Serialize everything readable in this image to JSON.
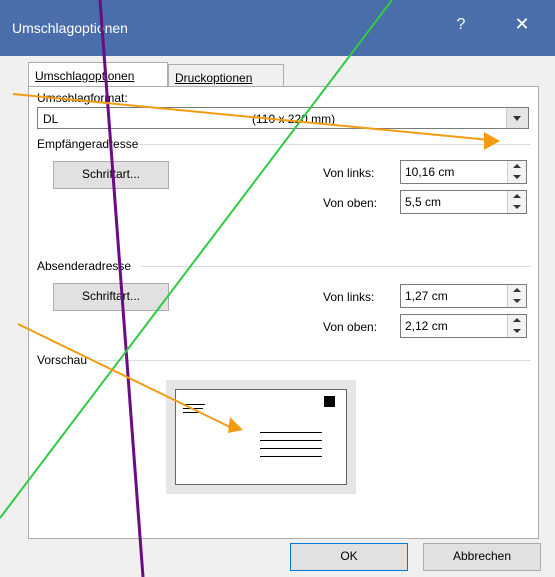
{
  "window": {
    "title": "Umschlagoptionen",
    "help_glyph": "?",
    "close_glyph": "✕"
  },
  "tabs": [
    {
      "label": "Umschlagoptionen",
      "active": true
    },
    {
      "label": "Druckoptionen",
      "active": false
    }
  ],
  "format": {
    "label": "Umschlagformat:",
    "value_name": "DL",
    "value_size": "(110 x 220 mm)"
  },
  "recipient": {
    "label": "Empfängeradresse",
    "font_button": "Schriftart...",
    "left_label": "Von links:",
    "left_value": "10,16 cm",
    "top_label": "Von oben:",
    "top_value": "5,5 cm"
  },
  "sender": {
    "label": "Absenderadresse",
    "font_button": "Schriftart...",
    "left_label": "Von links:",
    "left_value": "1,27 cm",
    "top_label": "Von oben:",
    "top_value": "2,12 cm"
  },
  "preview": {
    "label": "Vorschau"
  },
  "buttons": {
    "ok": "OK",
    "cancel": "Abbrechen"
  },
  "annotation_colors": {
    "purple": "#6a0d83",
    "green": "#2ecc40",
    "orange": "#f39c12"
  }
}
